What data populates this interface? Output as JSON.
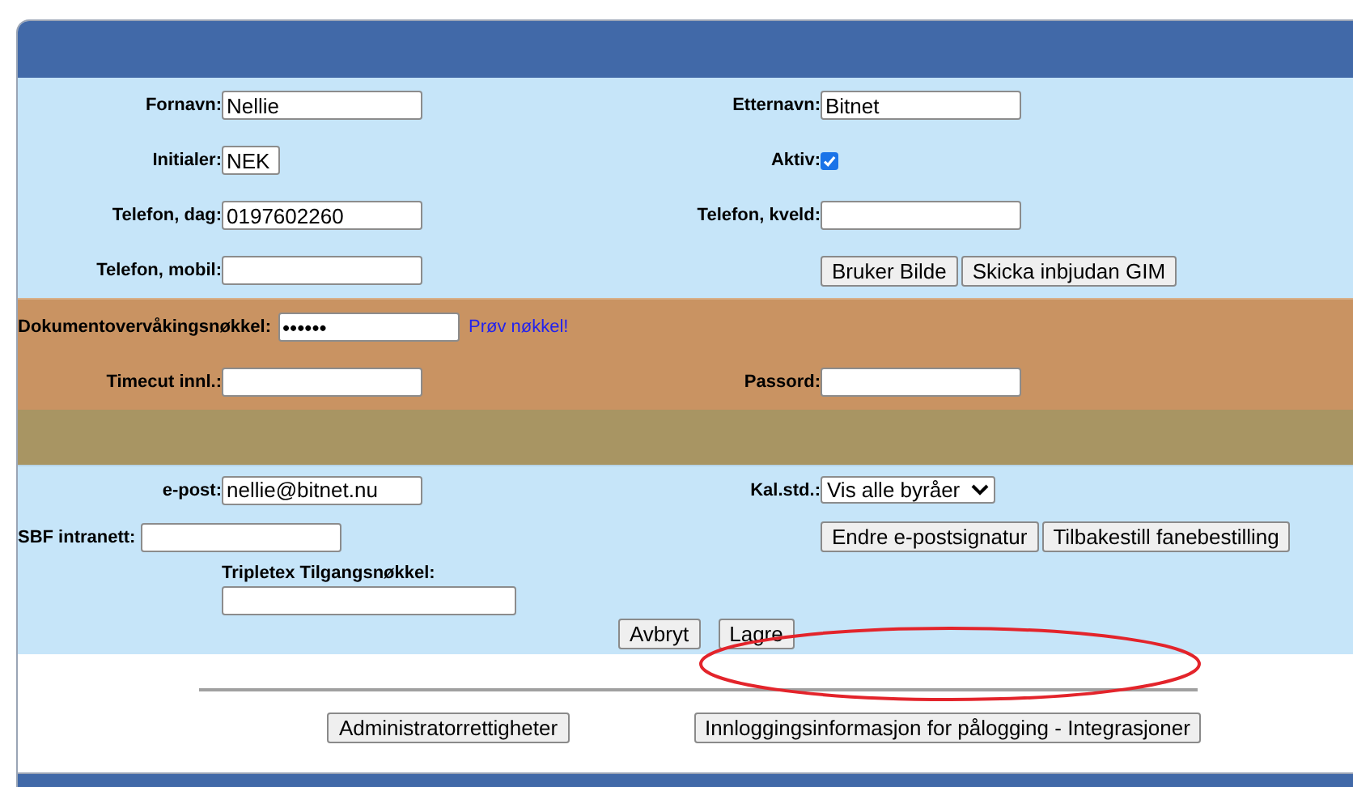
{
  "form": {
    "sections": [
      {
        "kind": "personal",
        "rows": [
          {
            "kind": "pair",
            "left": {
              "kind": "text",
              "label": "Fornavn:",
              "value": "Nellie"
            },
            "right": {
              "kind": "text",
              "label": "Etternavn:",
              "value": "Bitnet"
            }
          },
          {
            "kind": "pair",
            "left": {
              "kind": "short",
              "label": "Initialer:",
              "value": "NEK"
            },
            "right": {
              "kind": "checkbox",
              "label": "Aktiv:",
              "checked": true
            }
          },
          {
            "kind": "pair",
            "left": {
              "kind": "text",
              "label": "Telefon, dag:",
              "value": "0197602260"
            },
            "right": {
              "kind": "text",
              "label": "Telefon, kveld:"
            }
          },
          {
            "kind": "pair",
            "left": {
              "kind": "text",
              "label": "Telefon, mobil:"
            },
            "right": {
              "kind": "buttons",
              "buttons": [
                "Bruker Bilde",
                "Skicka inbjudan GIM"
              ]
            }
          }
        ]
      },
      {
        "kind": "security",
        "rows": [
          {
            "kind": "key",
            "label": "Dokumentovervåkingsnøkkel:",
            "value": "••••••",
            "link": "Prøv nøkkel!"
          },
          {
            "kind": "pair",
            "left": {
              "kind": "text",
              "label": "Timecut innl.:"
            },
            "right": {
              "kind": "text",
              "label": "Passord:"
            }
          }
        ]
      },
      {
        "kind": "blank"
      },
      {
        "kind": "contact",
        "rows": [
          {
            "kind": "pair",
            "left": {
              "kind": "text",
              "label": "e-post:",
              "value": "nellie@bitnet.nu"
            },
            "right": {
              "kind": "select",
              "label": "Kal.std.:",
              "value": "Vis alle byråer"
            }
          },
          {
            "kind": "pair",
            "left": {
              "kind": "inline",
              "label": "SBF intranett:"
            },
            "right": {
              "kind": "buttons",
              "buttons": [
                "Endre e-postsignatur",
                "Tilbakestill fanebestilling"
              ]
            }
          },
          {
            "kind": "stacked",
            "label": "Tripletex Tilgangsnøkkel:"
          },
          {
            "kind": "actions",
            "buttons": [
              "Avbryt",
              "Lagre"
            ]
          }
        ]
      }
    ],
    "footer_buttons": [
      "Administratorrettigheter",
      "Innloggingsinformasjon for pålogging - Integrasjoner"
    ]
  },
  "annotation": {
    "kind": "ellipse",
    "color": "#e3242b"
  }
}
